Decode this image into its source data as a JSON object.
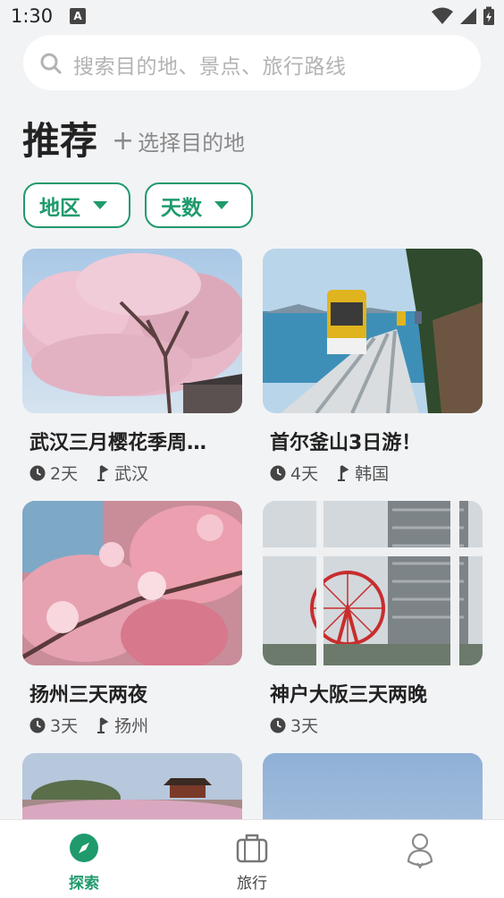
{
  "status": {
    "time": "1:30",
    "badge": "A"
  },
  "search": {
    "placeholder": "搜索目的地、景点、旅行路线"
  },
  "header": {
    "title": "推荐",
    "add_destination": "选择目的地"
  },
  "filters": [
    {
      "label": "地区"
    },
    {
      "label": "天数"
    }
  ],
  "cards": [
    {
      "title": "武汉三月樱花季周…",
      "days": "2天",
      "location": "武汉",
      "image": "cherry-blossom-tree"
    },
    {
      "title": "首尔釜山3日游！",
      "days": "4天",
      "location": "韩国",
      "image": "coastal-train"
    },
    {
      "title": "扬州三天两夜",
      "days": "3天",
      "location": "扬州",
      "image": "pink-blossom-closeup"
    },
    {
      "title": "神户大阪三天两晚",
      "days": "3天",
      "location": "",
      "image": "ferris-wheel"
    },
    {
      "title": "",
      "days": "",
      "location": "",
      "image": "palace-wall"
    },
    {
      "title": "",
      "days": "",
      "location": "",
      "image": "blue-sky"
    }
  ],
  "nav": [
    {
      "label": "探索",
      "icon": "compass-icon",
      "active": true
    },
    {
      "label": "旅行",
      "icon": "suitcase-icon",
      "active": false
    },
    {
      "label": "",
      "icon": "user-icon",
      "active": false
    }
  ],
  "colors": {
    "accent": "#1f9a6c",
    "background": "#f2f3f5",
    "text": "#222222"
  }
}
